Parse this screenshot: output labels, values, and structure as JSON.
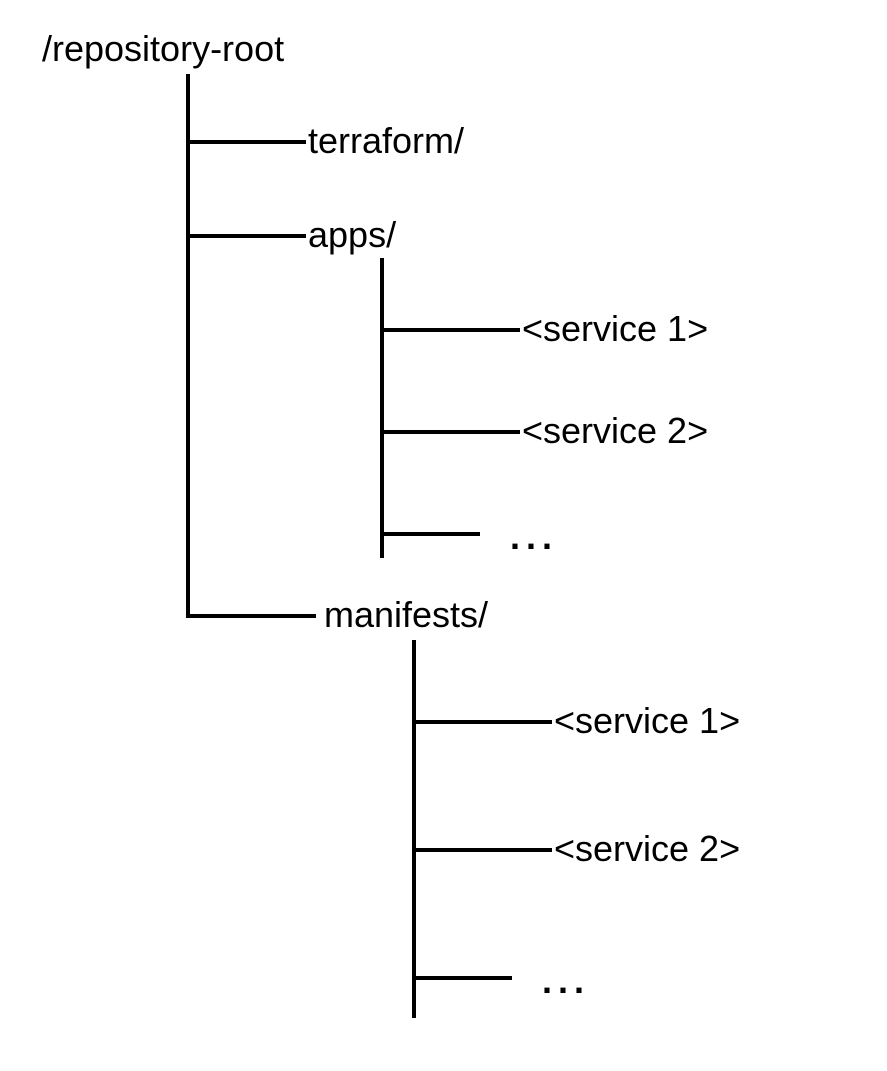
{
  "tree": {
    "root": "/repository-root",
    "children": [
      {
        "label": "terraform/"
      },
      {
        "label": "apps/",
        "children": [
          {
            "label": "<service 1>"
          },
          {
            "label": "<service 2>"
          },
          {
            "label": "..."
          }
        ]
      },
      {
        "label": "manifests/",
        "children": [
          {
            "label": "<service 1>"
          },
          {
            "label": "<service 2>"
          },
          {
            "label": "..."
          }
        ]
      }
    ]
  }
}
